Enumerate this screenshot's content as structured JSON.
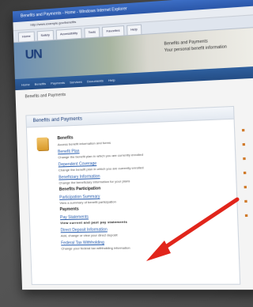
{
  "browser": {
    "title": "Benefits and Payments - Home - Windows Internet Explorer",
    "address": "http://www.example.gov/benefits",
    "tabs": [
      "Home",
      "Safety",
      "Accessibility",
      "Tools",
      "Favorites",
      "Help",
      "Feeds",
      "Print"
    ]
  },
  "banner": {
    "logo": "UN",
    "line1": "Benefits and Payments",
    "line2": "Your personal benefit information"
  },
  "nav": {
    "items": [
      "Home",
      "Benefits",
      "Payments",
      "Services",
      "Documents",
      "Help"
    ]
  },
  "breadcrumb": "Benefits and Payments",
  "panel": {
    "heading": "Benefits and Payments",
    "benefits_title": "Benefits",
    "benefits_intro": "Access benefit information and forms",
    "links": [
      {
        "label": "Benefit Plan",
        "desc": "Change the benefit plan in which you are currently enrolled"
      },
      {
        "label": "Dependent Coverage",
        "desc": "Change the benefit plan in which you are currently enrolled"
      },
      {
        "label": "Beneficiary Information",
        "desc": "Change the beneficiary information for your plans"
      }
    ],
    "payments_title": "Benefits Participation",
    "payments_link": "Participation Summary",
    "payments_desc": "View a summary of benefit participation",
    "payments2_title": "Payments",
    "payments2_link": "Pay Statements",
    "payments2_desc": "View current and past pay statements",
    "payments3_link": "Direct Deposit Information",
    "payments3_desc": "Add, change or view your direct deposit",
    "payments4_link": "Federal Tax Withholding",
    "payments4_desc": "Change your federal tax withholding information"
  },
  "colors": {
    "arrow": "#e1251b",
    "navbar": "#2e5f9e"
  }
}
